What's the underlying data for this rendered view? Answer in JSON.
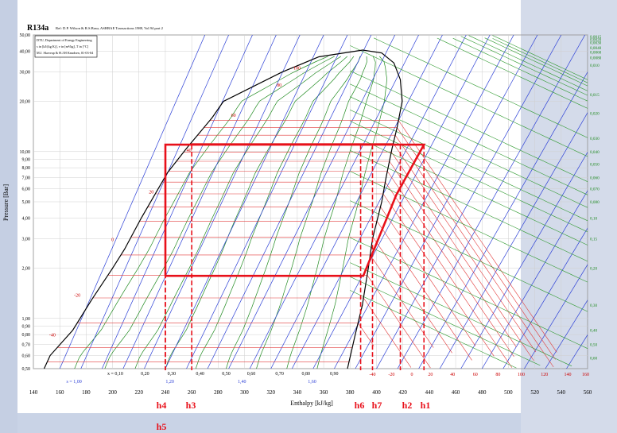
{
  "chart_data": {
    "type": "line",
    "title": "R134a",
    "title_sub": "Ref: D.P. Wilson & R.S.Basu, ASHRAE Transactions 1988, Vol.94 part 2",
    "info_box": [
      "DTU, Department of Energy Engineering",
      "s in [kJ/(kg K)], v in [m³/kg], T in [°C]",
      "M.J. Skovrup & H.J.H Knudsen, 01-03-04"
    ],
    "xlabel": "Enthalpy [kJ/kg]",
    "ylabel": "Pressure [Bar]",
    "x_scale": "linear",
    "y_scale": "log",
    "xlim": [
      140,
      560
    ],
    "ylim": [
      0.5,
      50
    ],
    "x_ticks": [
      140,
      160,
      180,
      200,
      220,
      240,
      260,
      280,
      300,
      320,
      340,
      360,
      380,
      400,
      420,
      440,
      460,
      480,
      500,
      520,
      540,
      560
    ],
    "x_tick_labels": [
      "140",
      "160",
      "180",
      "200",
      "220",
      "240",
      "260",
      "280",
      "300",
      "320",
      "340",
      "360",
      "380",
      "400",
      "420",
      "440",
      "460",
      "480",
      "500",
      "520",
      "540",
      "560"
    ],
    "y_ticks": [
      50,
      40,
      30,
      20,
      10,
      9,
      8,
      7,
      6,
      5,
      4,
      3,
      2,
      1,
      0.9,
      0.8,
      0.7,
      0.6,
      0.5
    ],
    "y_tick_labels": [
      "50,00",
      "40,00",
      "30,00",
      "20,00",
      "10,00",
      "9,00",
      "8,00",
      "7,00",
      "6,00",
      "5,00",
      "4,00",
      "3,00",
      "2,00",
      "1,00",
      "0,90",
      "0,80",
      "0,70",
      "0,60",
      "0,50"
    ],
    "grid": true,
    "saturation_dome": {
      "liquid_h": [
        148.14,
        152.7,
        169.8,
        184.3,
        200.0,
        209.1,
        221.8,
        241.8,
        256.3,
        275.6,
        284.0,
        328.6,
        356.4,
        389.6
      ],
      "liquid_p": [
        0.5,
        0.6,
        0.85,
        1.3,
        2.0,
        2.6,
        4.0,
        7.5,
        10.5,
        16.0,
        20.0,
        30.0,
        37.0,
        40.6
      ],
      "vapor_h": [
        389.6,
        404.0,
        413.2,
        418.1,
        419.5,
        415.7,
        411.9,
        407.3,
        404.0,
        397.0,
        393.8,
        389.3,
        383.9,
        378.0
      ],
      "vapor_p": [
        40.6,
        39.0,
        34.0,
        27.0,
        20.0,
        14.0,
        10.5,
        7.0,
        5.0,
        3.0,
        2.0,
        1.2,
        0.8,
        0.5
      ]
    },
    "quality_labels": [
      "x = 0,10",
      "0,20",
      "0,30",
      "0,40",
      "0,50",
      "0,60",
      "0,70",
      "0,80",
      "0,90"
    ],
    "quality_h": [
      202.0,
      224.6,
      244.8,
      266.3,
      286.1,
      305.1,
      326.6,
      346.5,
      367.9
    ],
    "quality_label_p": 0.5,
    "entropy_labels": [
      "s = 1,00",
      "1,20",
      "1,40",
      "1,60"
    ],
    "entropy_h": [
      170.8,
      243.4,
      298.0,
      351.2
    ],
    "entropy_label_p": 0.42,
    "isotherm_labels": [
      "-40",
      "-20",
      "0",
      "20",
      "40",
      "60",
      "80",
      "100"
    ],
    "isotherm_h": [
      154.4,
      173.2,
      200.0,
      229.3,
      257.9,
      291.6,
      326.3,
      339.8
    ],
    "isotherm_p": [
      0.78,
      1.35,
      2.9,
      5.6,
      10.0,
      16.2,
      24.5,
      31.0
    ],
    "bottom_temp_labels": [
      "-40",
      "-20",
      "0",
      "20",
      "40",
      "60",
      "80",
      "100",
      "120",
      "140",
      "160"
    ],
    "bottom_temp_h": [
      397.0,
      411.4,
      426.8,
      440.9,
      457.7,
      474.9,
      492.1,
      509.7,
      527.3,
      544.9,
      558.5
    ],
    "density_labels": [
      "0,0015",
      "0,0020",
      "0,0030",
      "0,0040",
      "0,0060",
      "0,0080",
      "0,010",
      "0,015",
      "0,020",
      "0,030",
      "0,040",
      "0,050",
      "0,060",
      "0,070",
      "0,080",
      "0,10",
      "0,15",
      "0,20",
      "0,30",
      "0,40",
      "0,50",
      "0,60"
    ],
    "density_p": [
      49.0,
      47.0,
      45.0,
      42.0,
      39.5,
      36.5,
      33.0,
      22.0,
      17.0,
      12.0,
      10.0,
      8.4,
      7.0,
      6.0,
      5.0,
      4.0,
      3.0,
      2.0,
      1.2,
      0.85,
      0.7,
      0.58
    ],
    "series": [
      {
        "name": "cycle",
        "color": "#e8101a",
        "h": [
          240.0,
          240.0,
          436.0,
          415.0,
          390.0,
          240.0
        ],
        "p": [
          1.8,
          11.0,
          11.0,
          5.5,
          1.8,
          1.8
        ]
      }
    ],
    "state_points": [
      {
        "label": "h1",
        "h": 436.0
      },
      {
        "label": "h2",
        "h": 418.1
      },
      {
        "label": "h3",
        "h": 260.0
      },
      {
        "label": "h4",
        "h": 240.0
      },
      {
        "label": "h5",
        "h": 240.0
      },
      {
        "label": "h6",
        "h": 388.0
      },
      {
        "label": "h7",
        "h": 397.0
      }
    ]
  }
}
